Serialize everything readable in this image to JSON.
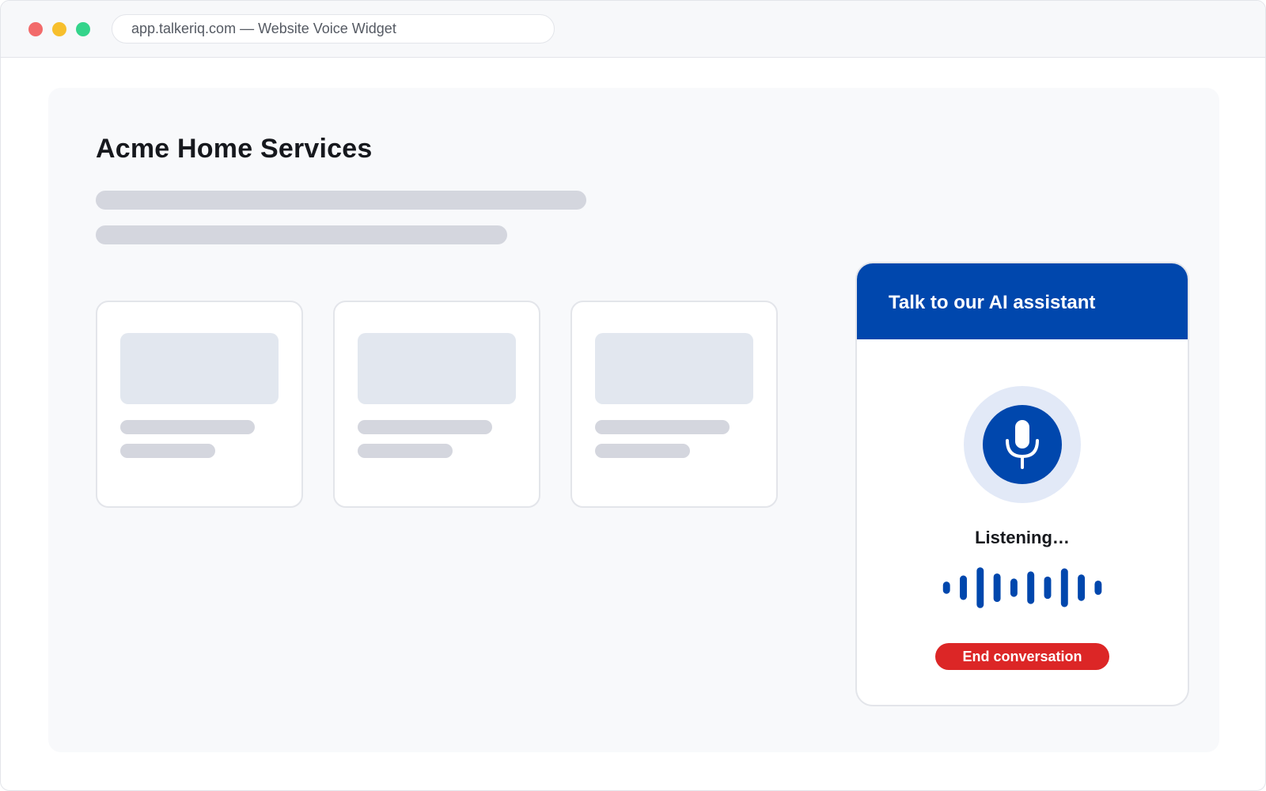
{
  "browser": {
    "url_text": "app.talkeriq.com — Website Voice Widget"
  },
  "page": {
    "title": "Acme Home Services"
  },
  "widget": {
    "header_title": "Talk to our AI assistant",
    "status": "Listening…",
    "end_button_label": "End conversation",
    "mic_icon": "microphone-icon",
    "waveform_levels": [
      0.3,
      0.6,
      1.0,
      0.7,
      0.45,
      0.8,
      0.55,
      0.95,
      0.65,
      0.35
    ]
  },
  "colors": {
    "accent": "#0047ad",
    "danger": "#dc2626",
    "mic_halo": "#e2e9f7"
  }
}
